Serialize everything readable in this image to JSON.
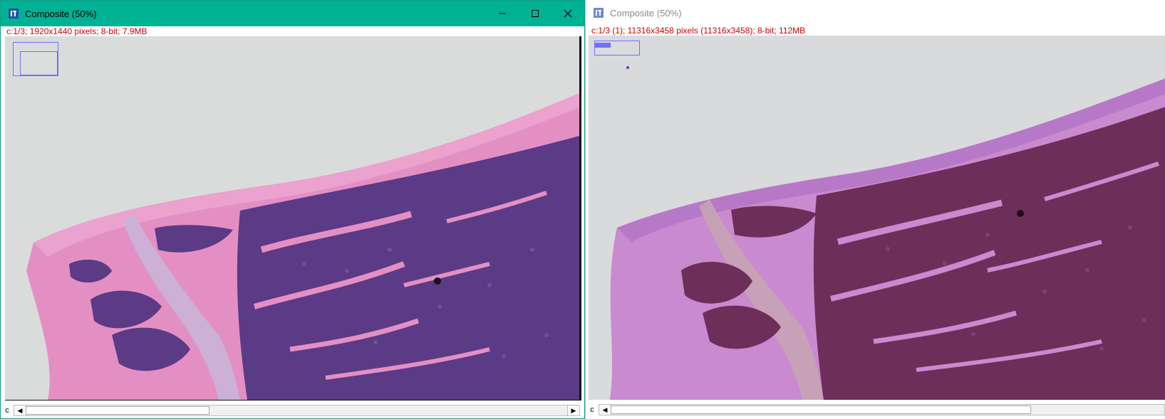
{
  "colors": {
    "active_titlebar": "#00b294",
    "info_text": "#d00000",
    "he_pink": "#e58fc4",
    "he_marrow": "#5c3a86",
    "alt_pink": "#c98ad0",
    "alt_marrow": "#6e2e5a",
    "navigator": "#7070ff"
  },
  "left_window": {
    "title": "Composite (50%)",
    "info": "c:1/3; 1920x1440 pixels; 8-bit; 7.9MB",
    "channel_label": "c",
    "controls": [
      "minimize-icon",
      "maximize-icon",
      "close-icon"
    ]
  },
  "right_window": {
    "title": "Composite (50%)",
    "info": "c:1/3 (1); 11316x3458 pixels (11316x3458); 8-bit; 112MB",
    "channel_label": "c"
  },
  "icons": {
    "app": "imagej-icon",
    "scroll_left": "arrow-left-icon",
    "scroll_right": "arrow-right-icon"
  }
}
